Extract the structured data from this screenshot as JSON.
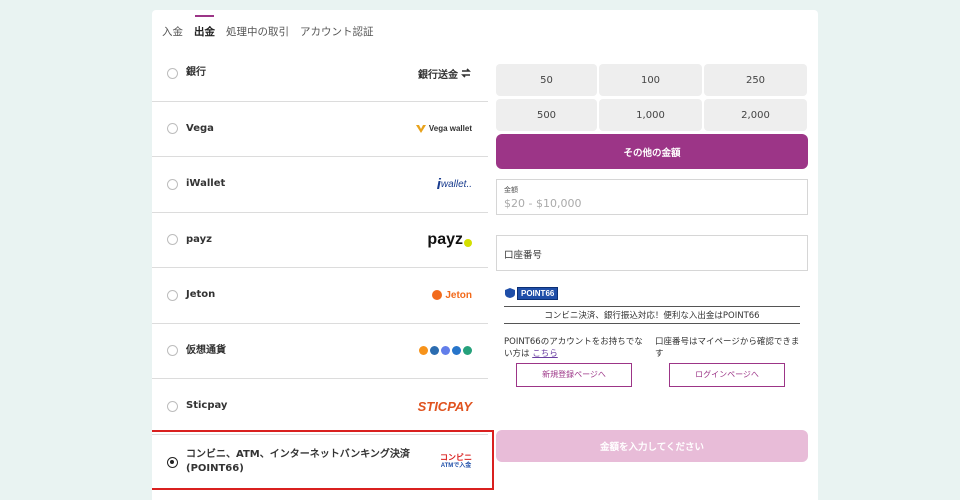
{
  "tabs": [
    {
      "label": "入金"
    },
    {
      "label": "出金",
      "active": true
    },
    {
      "label": "処理中の取引"
    },
    {
      "label": "アカウント認証"
    }
  ],
  "methods": [
    {
      "name": "銀行",
      "logo_text": "銀行送金",
      "logo_icon": "exchange-arrows-icon"
    },
    {
      "name": "Vega",
      "logo_text": "Vega wallet",
      "logo_icon": "vega-v-icon"
    },
    {
      "name": "iWallet",
      "logo_text": "wallet..",
      "logo_icon": "iwallet-i-icon"
    },
    {
      "name": "payz",
      "logo_text": "payz",
      "logo_icon": "payz-dot-icon"
    },
    {
      "name": "Jeton",
      "logo_text": "Jeton",
      "logo_icon": "jeton-icon"
    },
    {
      "name": "仮想通貨",
      "logo_icon": "crypto-coins-icon"
    },
    {
      "name": "Sticpay",
      "logo_text": "STICPAY"
    },
    {
      "name_line1": "コンビニ、ATM、インターネットバンキング決済",
      "name_line2": "(POINT66)",
      "logo_line1": "コンビニ",
      "logo_line2": "ATMで入金",
      "selected": true
    }
  ],
  "amounts": [
    "50",
    "100",
    "250",
    "500",
    "1,000",
    "2,000"
  ],
  "other_amount_label": "その他の金額",
  "amount_field": {
    "label": "金額",
    "placeholder": "$20 - $10,000"
  },
  "account_field": {
    "placeholder": "口座番号"
  },
  "point66": {
    "badge": "POINT66",
    "tagline": "コンビニ決済、銀行振込対応！便利な入出金はPOINT66",
    "left_text": "POINT66のアカウントをお持ちでない方は",
    "left_link": "こちら",
    "right_text": "口座番号はマイページから確認できます",
    "register_button": "新規登録ページへ",
    "login_button": "ログインページへ"
  },
  "submit_label": "金額を入力してください",
  "colors": {
    "accent": "#9c3587",
    "selected_border": "#d9201f",
    "submit_disabled": "#e8bcd8"
  }
}
